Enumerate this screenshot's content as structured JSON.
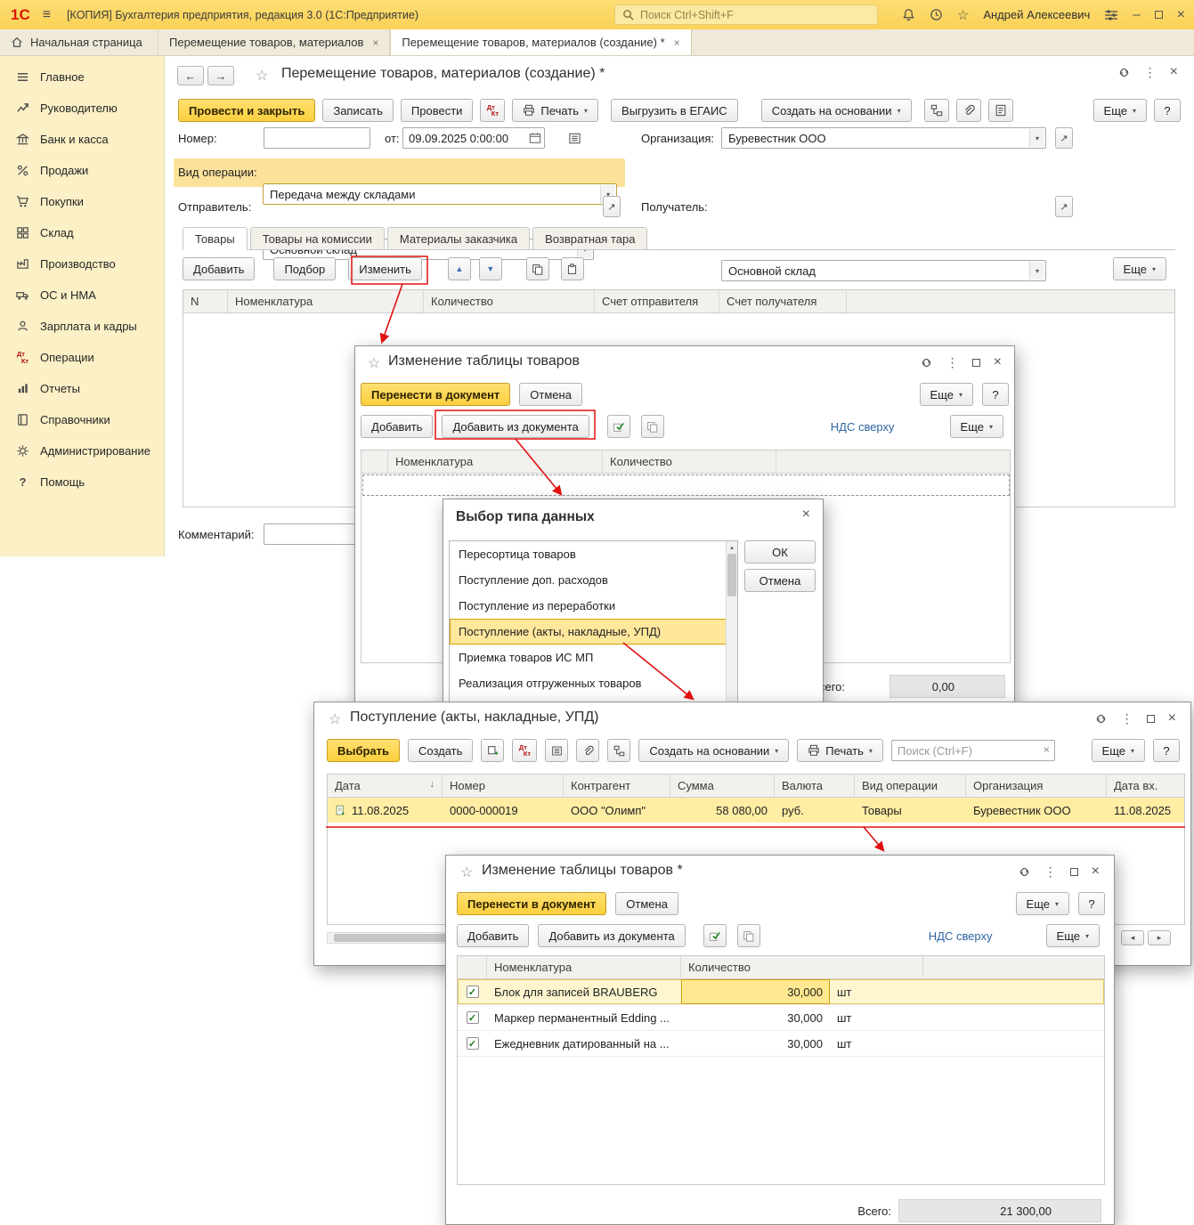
{
  "icons": {
    "caret": "▾",
    "close": "×",
    "kebab": "⋮",
    "star": "☆",
    "back": "←",
    "forward": "→",
    "sort_desc": "↓",
    "up": "▲",
    "down": "▼",
    "open": "↗",
    "check": "✓",
    "hamburger": "≡",
    "left": "◂",
    "right": "▸",
    "scroll_up": "▴",
    "question": "?",
    "minimize": "–"
  },
  "colors": {
    "accent_yellow": "#fbd256",
    "selection": "#ffe79c",
    "link": "#2e64a0",
    "marker_red": "#e01010"
  },
  "topbar": {
    "logo": "1С",
    "title": "[КОПИЯ] Бухгалтерия предприятия, редакция 3.0  (1С:Предприятие)",
    "search_placeholder": "Поиск Ctrl+Shift+F",
    "user": "Андрей Алексеевич"
  },
  "tabbar": {
    "tabs": [
      {
        "label": "Начальная страница"
      },
      {
        "label": "Перемещение товаров, материалов"
      },
      {
        "label": "Перемещение товаров, материалов (создание) *"
      }
    ]
  },
  "sidebar": {
    "items": [
      {
        "label": "Главное"
      },
      {
        "label": "Руководителю"
      },
      {
        "label": "Банк и касса"
      },
      {
        "label": "Продажи"
      },
      {
        "label": "Покупки"
      },
      {
        "label": "Склад"
      },
      {
        "label": "Производство"
      },
      {
        "label": "ОС и НМА"
      },
      {
        "label": "Зарплата и кадры"
      },
      {
        "label": "Операции"
      },
      {
        "label": "Отчеты"
      },
      {
        "label": "Справочники"
      },
      {
        "label": "Администрирование"
      },
      {
        "label": "Помощь"
      }
    ]
  },
  "doc": {
    "title": "Перемещение товаров, материалов (создание) *",
    "toolbar": {
      "post_close": "Провести и закрыть",
      "save": "Записать",
      "post": "Провести",
      "print": "Печать",
      "egais": "Выгрузить в ЕГАИС",
      "create_based": "Создать на основании",
      "more": "Еще"
    },
    "fields": {
      "number_label": "Номер:",
      "from_label": "от:",
      "date_value": "09.09.2025 0:00:00",
      "org_label": "Организация:",
      "org_value": "Буревестник ООО",
      "operation_label": "Вид операции:",
      "operation_value": "Передача между складами",
      "sender_label": "Отправитель:",
      "sender_value": "Основной склад",
      "receiver_label": "Получатель:",
      "receiver_value": "Основной склад",
      "comment_label": "Комментарий:"
    },
    "tabs": [
      "Товары",
      "Товары на комиссии",
      "Материалы заказчика",
      "Возвратная тара"
    ],
    "table_toolbar": {
      "add": "Добавить",
      "pick": "Подбор",
      "edit": "Изменить",
      "more": "Еще"
    },
    "table_headers": [
      "N",
      "Номенклатура",
      "Количество",
      "Счет отправителя",
      "Счет получателя"
    ]
  },
  "edit_dialog": {
    "title": "Изменение таблицы товаров",
    "transfer": "Перенести в документ",
    "cancel": "Отмена",
    "add": "Добавить",
    "add_from_doc": "Добавить из документа",
    "vat_link": "НДС сверху",
    "more": "Еще",
    "headers": [
      "Номенклатура",
      "Количество"
    ],
    "total_label": "Всего:",
    "total_value": "0,00"
  },
  "type_dialog": {
    "title": "Выбор типа данных",
    "items": [
      "Пересортица товаров",
      "Поступление доп. расходов",
      "Поступление из переработки",
      "Поступление (акты, накладные, УПД)",
      "Приемка товаров ИС МП",
      "Реализация отгруженных товаров"
    ],
    "ok": "ОК",
    "cancel": "Отмена"
  },
  "receipt_window": {
    "title": "Поступление (акты, накладные, УПД)",
    "toolbar": {
      "select": "Выбрать",
      "create": "Создать",
      "create_based": "Создать на основании",
      "print": "Печать",
      "search_placeholder": "Поиск (Ctrl+F)",
      "more": "Еще"
    },
    "headers": [
      "Дата",
      "Номер",
      "Контрагент",
      "Сумма",
      "Валюта",
      "Вид операции",
      "Организация",
      "Дата вх."
    ],
    "row": {
      "date": "11.08.2025",
      "number": "0000-000019",
      "contractor": "ООО \"Олимп\"",
      "sum": "58 080,00",
      "currency": "руб.",
      "operation": "Товары",
      "org": "Буревестник ООО",
      "date_in": "11.08.2025"
    }
  },
  "edit_dialog2": {
    "title": "Изменение таблицы товаров *",
    "transfer": "Перенести в документ",
    "cancel": "Отмена",
    "add": "Добавить",
    "add_from_doc": "Добавить из документа",
    "vat_link": "НДС сверху",
    "more": "Еще",
    "headers": [
      "Номенклатура",
      "Количество"
    ],
    "rows": [
      {
        "name": "Блок для записей BRAUBERG",
        "qty": "30,000",
        "unit": "шт"
      },
      {
        "name": "Маркер перманентный Edding ...",
        "qty": "30,000",
        "unit": "шт"
      },
      {
        "name": "Ежедневник датированный на ...",
        "qty": "30,000",
        "unit": "шт"
      }
    ],
    "total_label": "Всего:",
    "total_value": "21 300,00"
  }
}
